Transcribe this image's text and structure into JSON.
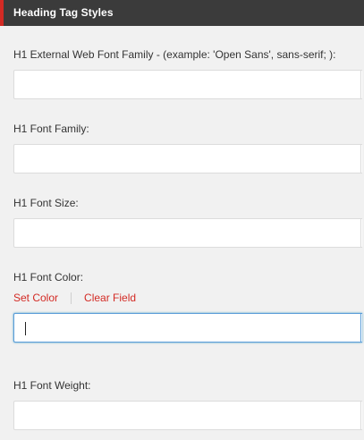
{
  "section": {
    "title": "Heading Tag Styles"
  },
  "fields": {
    "h1_external_font": {
      "label": "H1 External Web Font Family - (example: 'Open Sans', sans-serif; ):",
      "value": ""
    },
    "h1_font_family": {
      "label": "H1 Font Family:",
      "value": ""
    },
    "h1_font_size": {
      "label": "H1 Font Size:",
      "value": ""
    },
    "h1_font_color": {
      "label": "H1 Font Color:",
      "value": "",
      "set_color_label": "Set Color",
      "clear_field_label": "Clear Field"
    },
    "h1_font_weight": {
      "label": "H1 Font Weight:",
      "value": ""
    }
  },
  "colors": {
    "header_bg": "#3b3b3b",
    "accent": "#d32a24",
    "link": "#d32a24",
    "focus_border": "#5b9dd9"
  }
}
